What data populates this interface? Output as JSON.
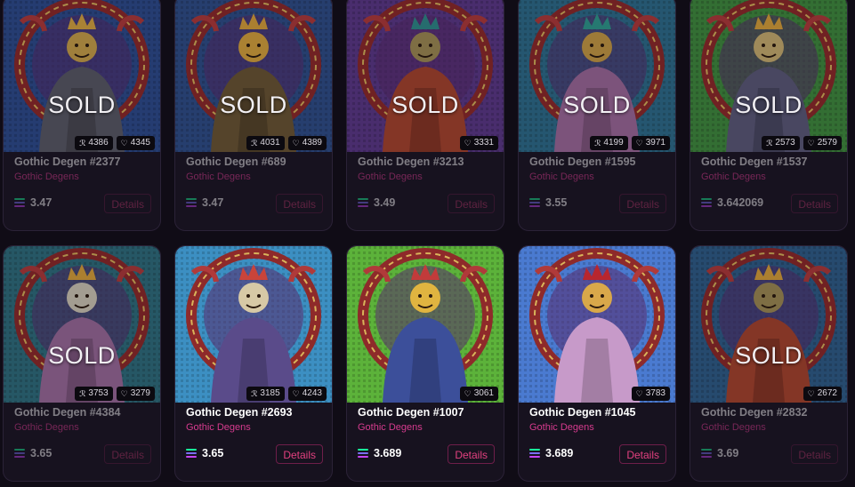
{
  "cards": [
    {
      "title": "Gothic Degen #2377",
      "collection": "Gothic Degens",
      "price": "3.47",
      "details": "Details",
      "sold": true,
      "sold_text": "SOLD",
      "rank": "4386",
      "likes": "4345",
      "bg": "#2d4c8e",
      "cloak": "#595a66",
      "face": "#c9a24a",
      "crown": "#d6a640"
    },
    {
      "title": "Gothic Degen #689",
      "collection": "Gothic Degens",
      "price": "3.47",
      "details": "Details",
      "sold": true,
      "sold_text": "SOLD",
      "rank": "4031",
      "likes": "4389",
      "bg": "#2f4f8a",
      "cloak": "#6b5634",
      "face": "#d8a43d",
      "crown": "#d9a23a"
    },
    {
      "title": "Gothic Degen #3213",
      "collection": "Gothic Degens",
      "price": "3.49",
      "details": "Details",
      "sold": true,
      "sold_text": "SOLD",
      "rank": "",
      "likes": "3331",
      "bg": "#5b3988",
      "cloak": "#a7442e",
      "face": "#9f8c54",
      "crown": "#2f8a8a"
    },
    {
      "title": "Gothic Degen #1595",
      "collection": "Gothic Degens",
      "price": "3.55",
      "details": "Details",
      "sold": true,
      "sold_text": "SOLD",
      "rank": "4199",
      "likes": "3971",
      "bg": "#2e6e8c",
      "cloak": "#9d6a9a",
      "face": "#c79b45",
      "crown": "#2f9a8e"
    },
    {
      "title": "Gothic Degen #1537",
      "collection": "Gothic Degens",
      "price": "3.642069",
      "details": "Details",
      "sold": true,
      "sold_text": "SOLD",
      "rank": "2573",
      "likes": "2579",
      "bg": "#3f8c3e",
      "cloak": "#5b5a79",
      "face": "#c9b070",
      "crown": "#d9a23a"
    },
    {
      "title": "Gothic Degen #4384",
      "collection": "Gothic Degens",
      "price": "3.65",
      "details": "Details",
      "sold": true,
      "sold_text": "SOLD",
      "rank": "3753",
      "likes": "3279",
      "bg": "#2f6f7e",
      "cloak": "#9a6b9a",
      "face": "#cfc8b6",
      "crown": "#d9a23a"
    },
    {
      "title": "Gothic Degen #2693",
      "collection": "Gothic Degens",
      "price": "3.65",
      "details": "Details",
      "sold": false,
      "sold_text": "",
      "rank": "3185",
      "likes": "4243",
      "bg": "#3c8fc2",
      "cloak": "#5a4b8a",
      "face": "#d7c9a6",
      "crown": "#c9443a"
    },
    {
      "title": "Gothic Degen #1007",
      "collection": "Gothic Degens",
      "price": "3.689",
      "details": "Details",
      "sold": false,
      "sold_text": "",
      "rank": "",
      "likes": "3061",
      "bg": "#5cb23a",
      "cloak": "#3c4f9a",
      "face": "#e0b440",
      "crown": "#c23b3b"
    },
    {
      "title": "Gothic Degen #1045",
      "collection": "Gothic Degens",
      "price": "3.689",
      "details": "Details",
      "sold": false,
      "sold_text": "",
      "rank": "",
      "likes": "3783",
      "bg": "#4a7ad0",
      "cloak": "#c79ac9",
      "face": "#d9a84a",
      "crown": "#b8262e"
    },
    {
      "title": "Gothic Degen #2832",
      "collection": "Gothic Degens",
      "price": "3.69",
      "details": "Details",
      "sold": true,
      "sold_text": "SOLD",
      "rank": "",
      "likes": "2672",
      "bg": "#2f5e8a",
      "cloak": "#a7442e",
      "face": "#9f8c54",
      "crown": "#d9a23a"
    }
  ],
  "icons": {
    "rank": "rarity-icon",
    "likes": "heart-icon",
    "currency": "solana-icon"
  }
}
